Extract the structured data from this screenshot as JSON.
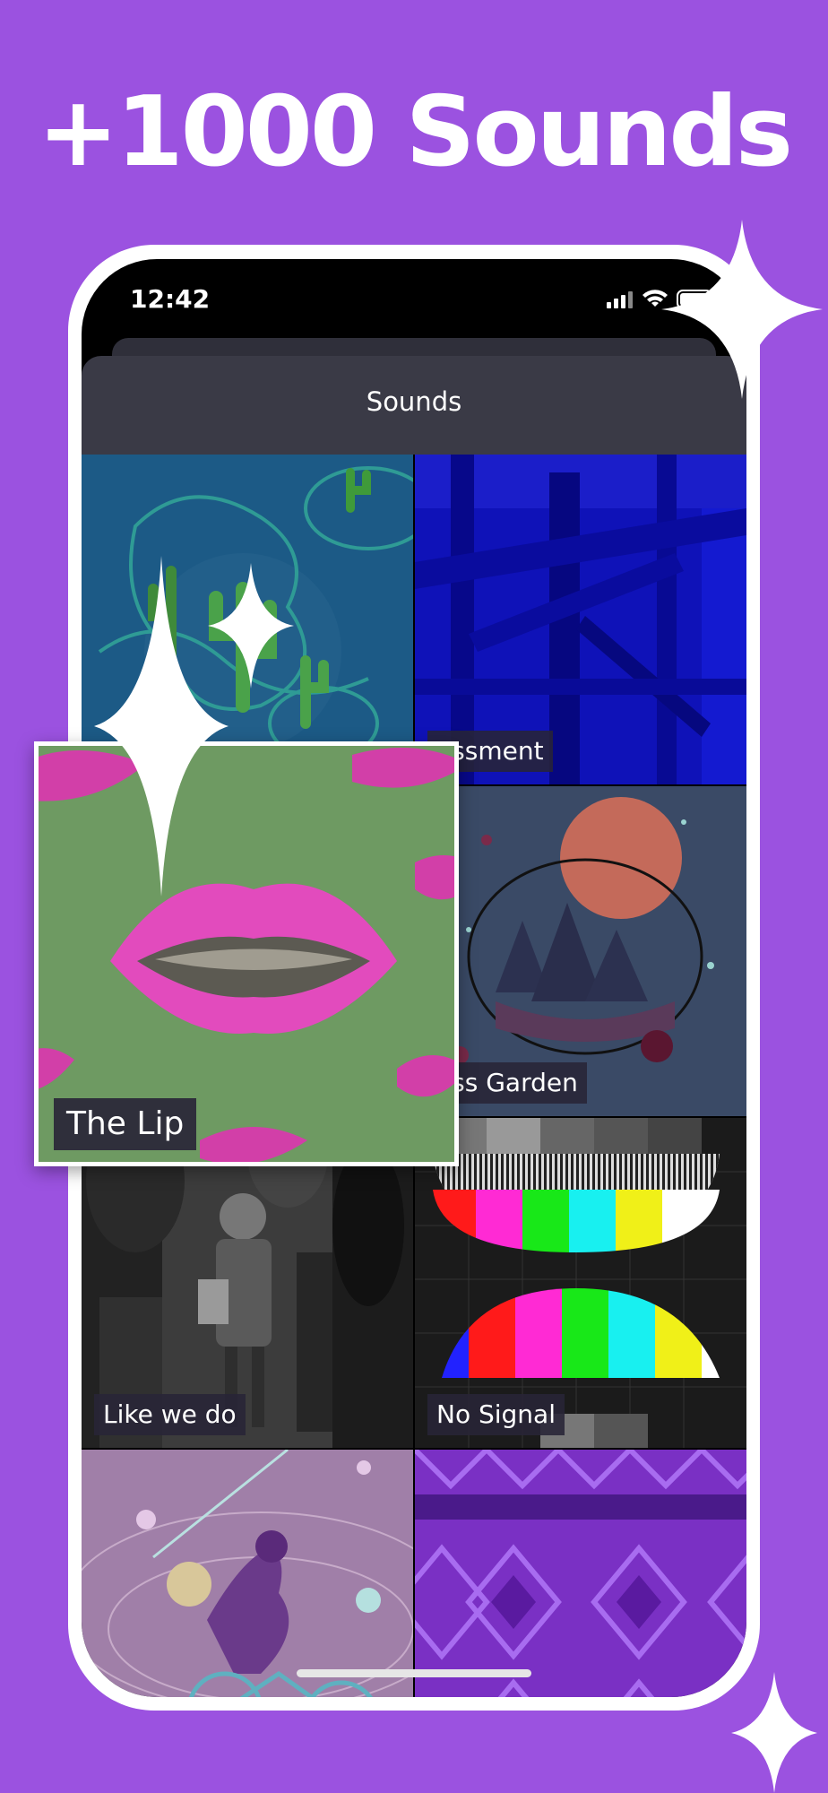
{
  "headline": "+1000 Sounds",
  "status_bar": {
    "time": "12:42",
    "icons": [
      "cellular-signal-icon",
      "wifi-icon",
      "battery-icon"
    ]
  },
  "sheet": {
    "title": "Sounds"
  },
  "sound_tiles": [
    {
      "label": ""
    },
    {
      "label": "assment"
    },
    {
      "label": ""
    },
    {
      "label": "ass Garden"
    },
    {
      "label": "Like we do"
    },
    {
      "label": "No Signal"
    },
    {
      "label": ""
    },
    {
      "label": ""
    }
  ],
  "featured_popup": {
    "label": "The Lip"
  },
  "colors": {
    "background": "#9b52e0",
    "frame": "#ffffff",
    "sheet_header": "#3a3a46",
    "label_bg": "#282437"
  }
}
